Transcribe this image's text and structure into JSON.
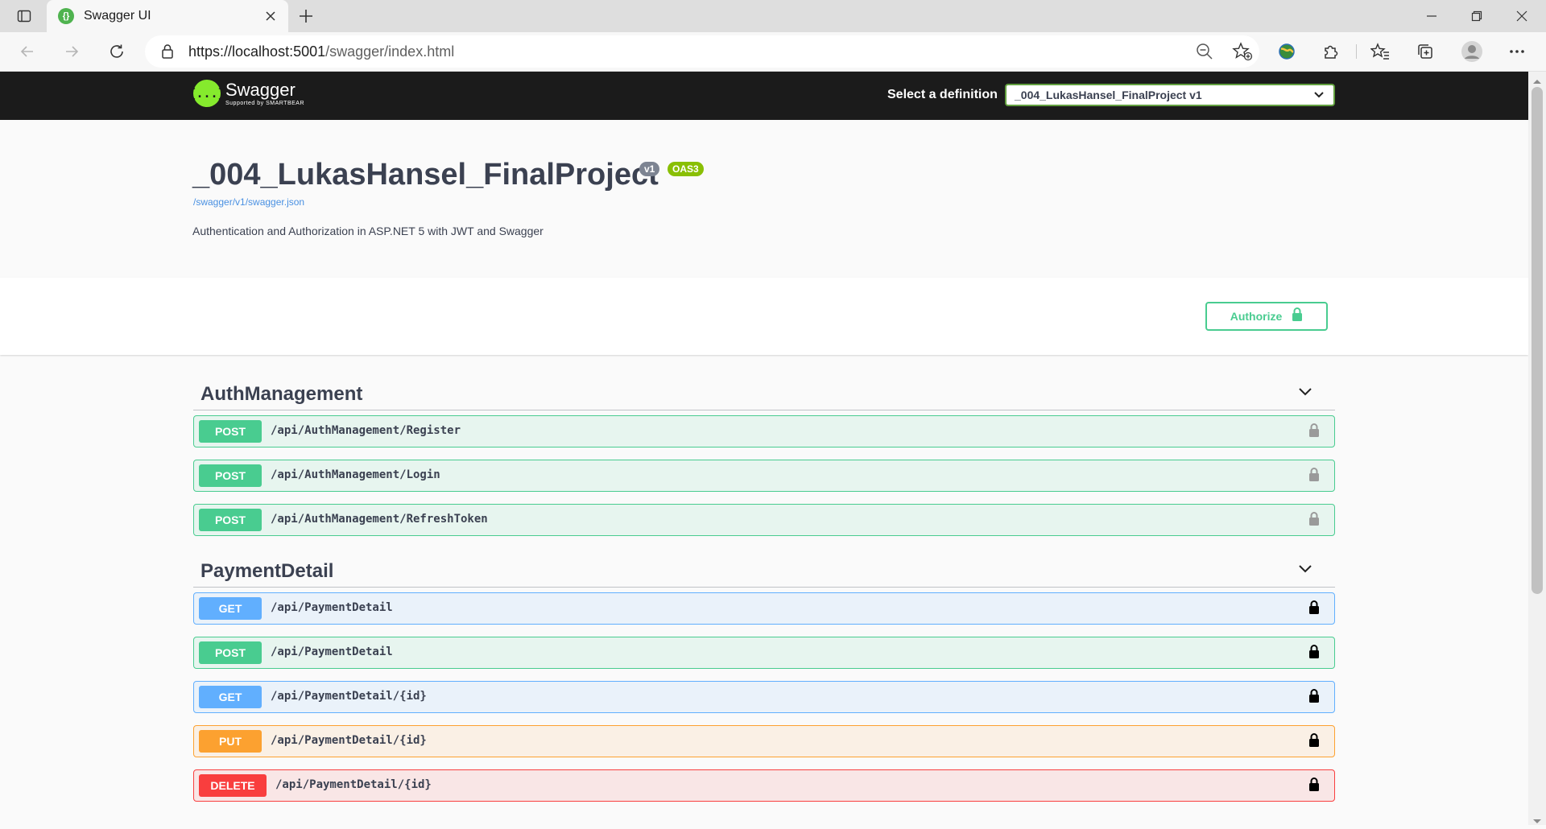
{
  "browser": {
    "tab_title": "Swagger UI",
    "url_host": "https://localhost:5001",
    "url_path": "/swagger/index.html"
  },
  "swagger": {
    "logo_name": "Swagger",
    "logo_by": "Supported by SMARTBEAR",
    "logo_mark": "{...}",
    "definition_label": "Select a definition",
    "definition_value": "_004_LukasHansel_FinalProject v1"
  },
  "info": {
    "title": "_004_LukasHansel_FinalProject",
    "version_badge": "v1",
    "oas_badge": "OAS3",
    "spec_link": "/swagger/v1/swagger.json",
    "description": "Authentication and Authorization in ASP.NET 5 with JWT and Swagger"
  },
  "authorize_label": "Authorize",
  "tags": [
    {
      "name": "AuthManagement",
      "operations": [
        {
          "method": "POST",
          "path": "/api/AuthManagement/Register",
          "locked": false
        },
        {
          "method": "POST",
          "path": "/api/AuthManagement/Login",
          "locked": false
        },
        {
          "method": "POST",
          "path": "/api/AuthManagement/RefreshToken",
          "locked": false
        }
      ]
    },
    {
      "name": "PaymentDetail",
      "operations": [
        {
          "method": "GET",
          "path": "/api/PaymentDetail",
          "locked": true
        },
        {
          "method": "POST",
          "path": "/api/PaymentDetail",
          "locked": true
        },
        {
          "method": "GET",
          "path": "/api/PaymentDetail/{id}",
          "locked": true
        },
        {
          "method": "PUT",
          "path": "/api/PaymentDetail/{id}",
          "locked": true
        },
        {
          "method": "DELETE",
          "path": "/api/PaymentDetail/{id}",
          "locked": true
        }
      ]
    }
  ],
  "colors": {
    "post": "#49cc90",
    "get": "#61affe",
    "put": "#fca130",
    "delete": "#f93e3e",
    "topbar": "#1b1b1b",
    "swagger_green": "#85ea2d"
  }
}
